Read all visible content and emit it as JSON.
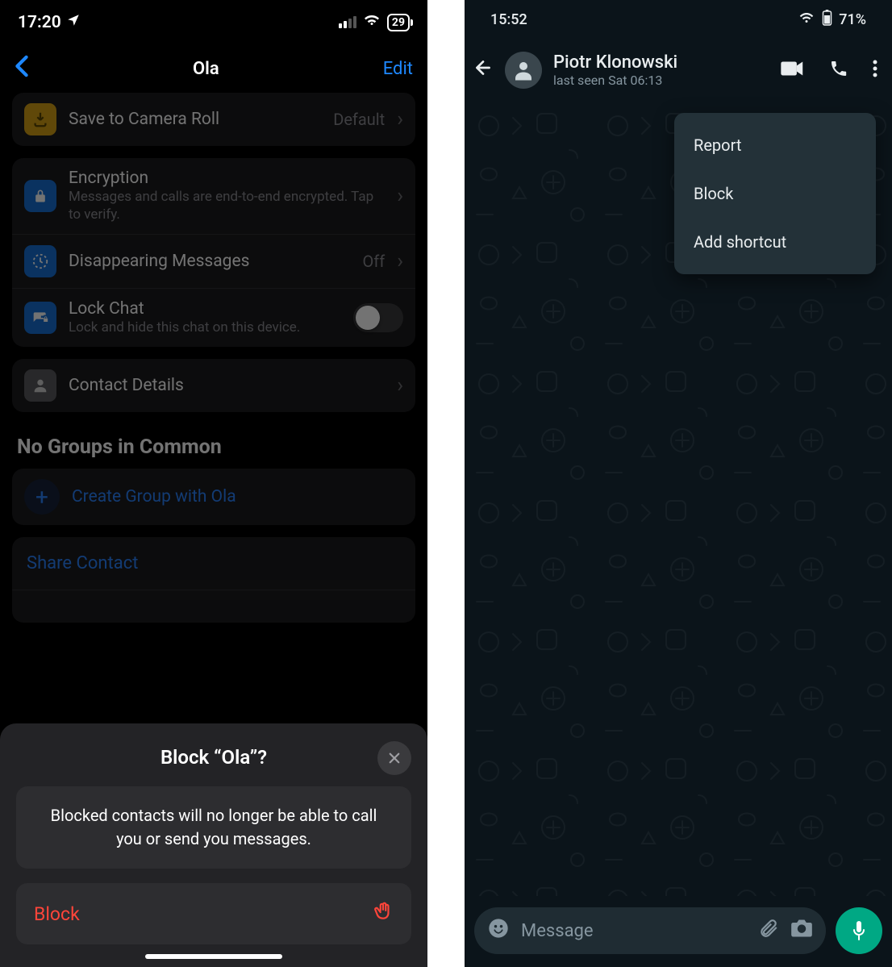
{
  "ios": {
    "status": {
      "time": "17:20",
      "battery": "29"
    },
    "nav": {
      "title": "Ola",
      "edit": "Edit"
    },
    "settings": {
      "camera_roll": {
        "label": "Save to Camera Roll",
        "value": "Default"
      },
      "encryption": {
        "label": "Encryption",
        "sub": "Messages and calls are end-to-end encrypted. Tap to verify."
      },
      "disappearing": {
        "label": "Disappearing Messages",
        "value": "Off"
      },
      "lock_chat": {
        "label": "Lock Chat",
        "sub": "Lock and hide this chat on this device."
      },
      "contact_details": {
        "label": "Contact Details"
      }
    },
    "groups_header": "No Groups in Common",
    "create_group": "Create Group with Ola",
    "share_contact": "Share Contact",
    "sheet": {
      "title": "Block “Ola”?",
      "message": "Blocked contacts will no longer be able to call you or send you messages.",
      "action": "Block"
    }
  },
  "android": {
    "status": {
      "time": "15:52",
      "battery": "71%"
    },
    "header": {
      "name": "Piotr Klonowski",
      "last_seen": "last seen Sat 06:13"
    },
    "menu": {
      "report": "Report",
      "block": "Block",
      "shortcut": "Add shortcut"
    },
    "input_placeholder": "Message"
  }
}
